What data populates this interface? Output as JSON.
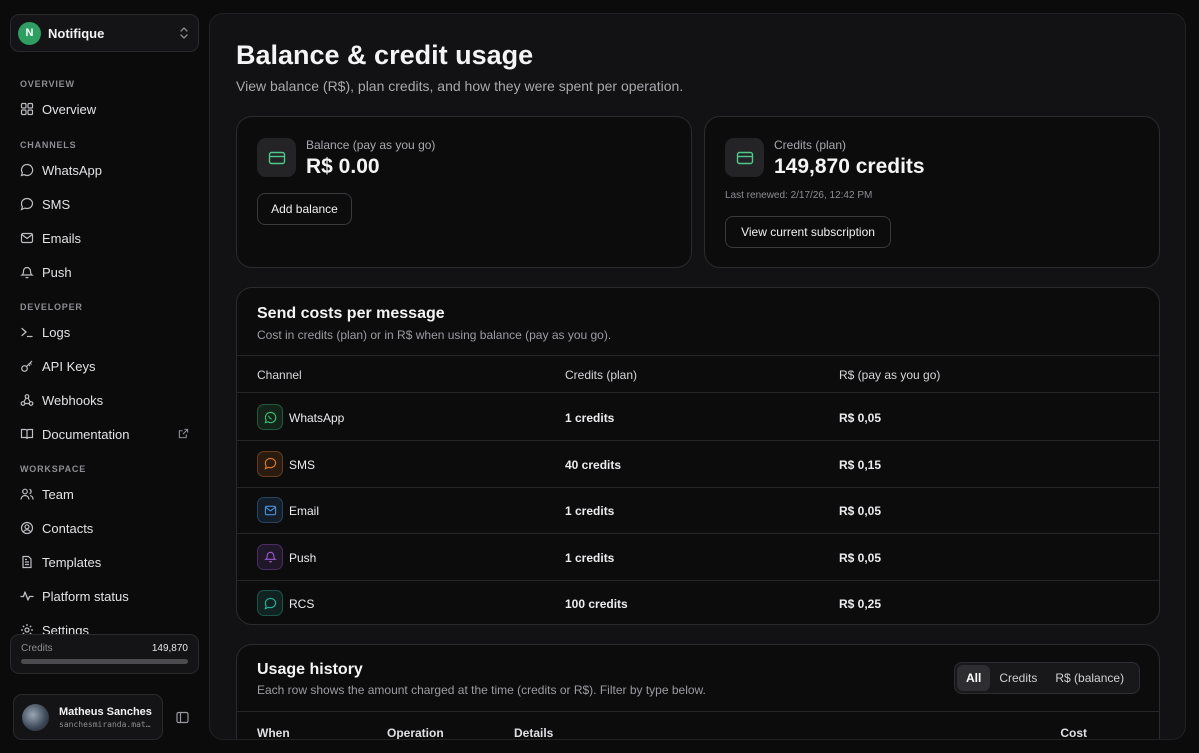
{
  "workspace": {
    "initial": "N",
    "name": "Notifique"
  },
  "sidebar": {
    "sections": {
      "overview": "OVERVIEW",
      "channels": "CHANNELS",
      "developer": "DEVELOPER",
      "workspace": "WORKSPACE"
    },
    "items": {
      "overview": "Overview",
      "whatsapp": "WhatsApp",
      "sms": "SMS",
      "emails": "Emails",
      "push": "Push",
      "logs": "Logs",
      "api_keys": "API Keys",
      "webhooks": "Webhooks",
      "documentation": "Documentation",
      "team": "Team",
      "contacts": "Contacts",
      "templates": "Templates",
      "platform_status": "Platform status",
      "settings": "Settings"
    },
    "credits": {
      "label": "Credits",
      "value": "149,870",
      "progress_fraction": 1.0
    },
    "user": {
      "name": "Matheus Sanches",
      "email": "sanchesmiranda.matheus@gmail.com"
    }
  },
  "page": {
    "title": "Balance & credit usage",
    "subtitle": "View balance (R$), plan credits, and how they were spent per operation."
  },
  "balance_card": {
    "label": "Balance (pay as you go)",
    "value": "R$ 0.00",
    "button": "Add balance"
  },
  "credits_card": {
    "label": "Credits (plan)",
    "value": "149,870 credits",
    "renewed": "Last renewed: 2/17/26, 12:42 PM",
    "button": "View current subscription"
  },
  "costs": {
    "title": "Send costs per message",
    "subtitle": "Cost in credits (plan) or in R$ when using balance (pay as you go).",
    "columns": {
      "channel": "Channel",
      "credits": "Credits (plan)",
      "payg": "R$ (pay as you go)"
    },
    "rows": [
      {
        "channel": "WhatsApp",
        "credits": "1 credits",
        "payg": "R$ 0,05",
        "icon": "whatsapp-icon",
        "color": "#3fbf74"
      },
      {
        "channel": "SMS",
        "credits": "40 credits",
        "payg": "R$ 0,15",
        "icon": "chat-bubble-icon",
        "color": "#e07a2e"
      },
      {
        "channel": "Email",
        "credits": "1 credits",
        "payg": "R$ 0,05",
        "icon": "mail-icon",
        "color": "#4a8fd6"
      },
      {
        "channel": "Push",
        "credits": "1 credits",
        "payg": "R$ 0,05",
        "icon": "bell-icon",
        "color": "#9a5ad6"
      },
      {
        "channel": "RCS",
        "credits": "100 credits",
        "payg": "R$ 0,25",
        "icon": "chat-bubble-icon",
        "color": "#2fb39a"
      }
    ]
  },
  "history": {
    "title": "Usage history",
    "subtitle": "Each row shows the amount charged at the time (credits or R$). Filter by type below.",
    "filters": [
      "All",
      "Credits",
      "R$ (balance)"
    ],
    "selected_filter": "All",
    "columns": {
      "when": "When",
      "operation": "Operation",
      "details": "Details",
      "cost": "Cost"
    }
  }
}
